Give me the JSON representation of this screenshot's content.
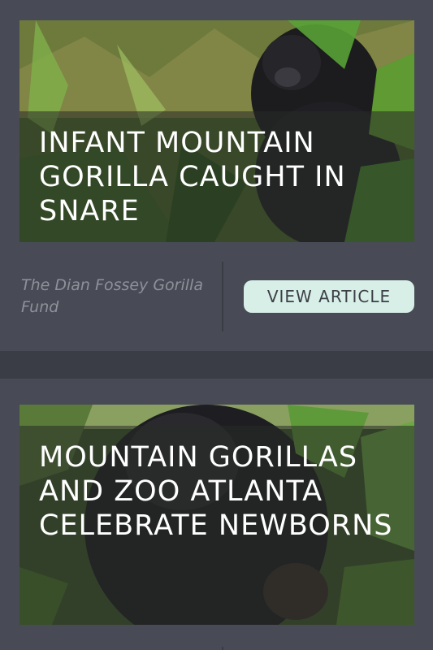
{
  "articles": [
    {
      "headline": "INFANT MOUNTAIN GORILLA CAUGHT IN SNARE",
      "source": "The Dian Fossey Gorilla Fund",
      "button_label": "VIEW ARTICLE"
    },
    {
      "headline": "MOUNTAIN GORILLAS AND ZOO ATLANTA CELEBRATE NEWBORNS"
    }
  ],
  "colors": {
    "page_background": "#3a3d46",
    "card_background": "#484b55",
    "button_background": "#d7efe6",
    "source_text": "#8e909a"
  }
}
